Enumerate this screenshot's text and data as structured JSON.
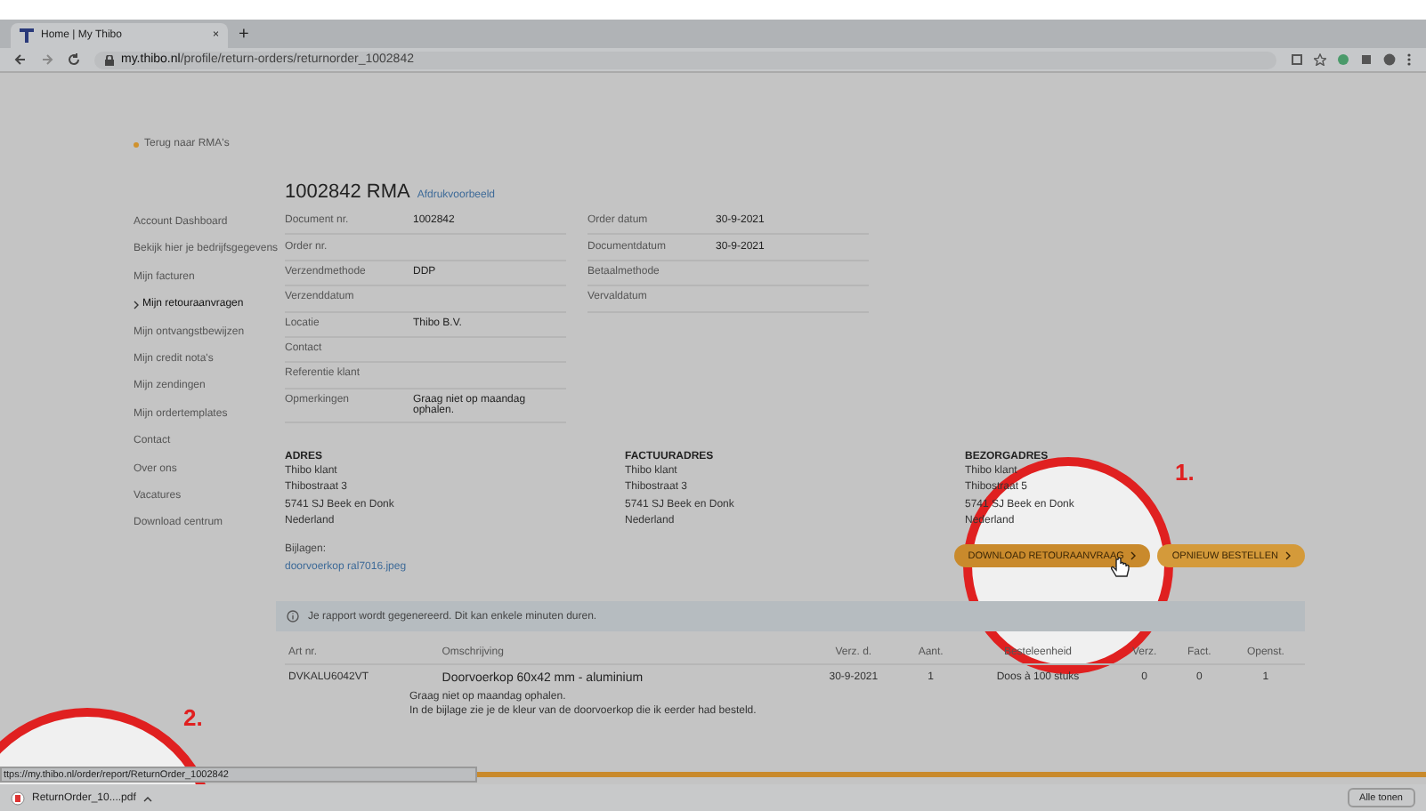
{
  "browser": {
    "tab_title": "Home | My Thibo",
    "tab_close": "×",
    "new_tab": "+",
    "url_host": "my.thibo.nl",
    "url_path": "/profile/return-orders/returnorder_1002842"
  },
  "back_link": "Terug naar RMA's",
  "sidebar": {
    "items": [
      {
        "label": "Account Dashboard",
        "selected": false
      },
      {
        "label": "Bekijk hier je bedrijfsgegevens",
        "selected": false
      },
      {
        "label": "Mijn facturen",
        "selected": false
      },
      {
        "label": "Mijn retouraanvragen",
        "selected": true
      },
      {
        "label": "Mijn ontvangstbewijzen",
        "selected": false
      },
      {
        "label": "Mijn credit nota's",
        "selected": false
      },
      {
        "label": "Mijn zendingen",
        "selected": false
      },
      {
        "label": "Mijn ordertemplates",
        "selected": false
      },
      {
        "label": "Contact",
        "selected": false
      },
      {
        "label": "Over ons",
        "selected": false
      },
      {
        "label": "Vacatures",
        "selected": false
      },
      {
        "label": "Download centrum",
        "selected": false
      }
    ]
  },
  "heading": {
    "number": "1002842 RMA",
    "print_link": "Afdrukvoorbeeld"
  },
  "details_left": [
    {
      "label": "Document nr.",
      "value": "1002842"
    },
    {
      "label": "Order nr."
    },
    {
      "label": "Verzendmethode",
      "value": "DDP"
    },
    {
      "label": "Verzenddatum"
    },
    {
      "label": "Locatie",
      "value": "Thibo B.V."
    },
    {
      "label": "Contact"
    },
    {
      "label": "Referentie klant"
    },
    {
      "label": "Opmerkingen",
      "value": "Graag niet op maandag ophalen."
    }
  ],
  "details_right": [
    {
      "label": "Order datum",
      "value": "30-9-2021"
    },
    {
      "label": "Documentdatum",
      "value": "30-9-2021"
    },
    {
      "label": "Betaalmethode"
    },
    {
      "label": "Vervaldatum"
    }
  ],
  "addresses": [
    {
      "heading": "ADRES",
      "lines": [
        "Thibo klant",
        "Thibostraat 3",
        "5741 SJ Beek en Donk",
        "Nederland"
      ]
    },
    {
      "heading": "FACTUURADRES",
      "lines": [
        "Thibo klant",
        "Thibostraat 3",
        "5741 SJ Beek en Donk",
        "Nederland"
      ]
    },
    {
      "heading": "BEZORGADRES",
      "lines": [
        "Thibo klant",
        "Thibostraat 5",
        "5741 SJ Beek en Donk",
        "Nederland"
      ]
    }
  ],
  "attachments": {
    "label": "Bijlagen:",
    "files": [
      "doorvoerkop ral7016.jpeg"
    ]
  },
  "buttons": [
    {
      "label": "DOWNLOAD RETOURAANVRAAG",
      "kind": "primary"
    },
    {
      "label": "OPNIEUW BESTELLEN",
      "kind": "secondary"
    }
  ],
  "info": "Je rapport wordt gegenereerd. Dit kan enkele minuten duren.",
  "lines_table": {
    "columns": [
      "Art nr.",
      "Omschrijving",
      "Verz. d.",
      "Aant.",
      "Besteleenheid",
      "Verz.",
      "Fact.",
      "Openst."
    ],
    "rows": [
      {
        "cells": [
          "DVKALU6042VT",
          "Doorvoerkop 60x42 mm - aluminium",
          "30-9-2021",
          "1",
          "Doos à 100 stuks",
          "0",
          "0",
          "1"
        ],
        "notes": [
          "Graag niet op maandag ophalen.",
          "In de bijlage zie je de kleur van de doorvoerkop die ik eerder had besteld."
        ]
      }
    ]
  },
  "status_url": "ttps://my.thibo.nl/order/report/ReturnOrder_1002842",
  "download_bar": {
    "file": "ReturnOrder_10....pdf",
    "show_all": "Alle tonen"
  },
  "annotations": [
    {
      "label": "1."
    },
    {
      "label": "2."
    }
  ]
}
